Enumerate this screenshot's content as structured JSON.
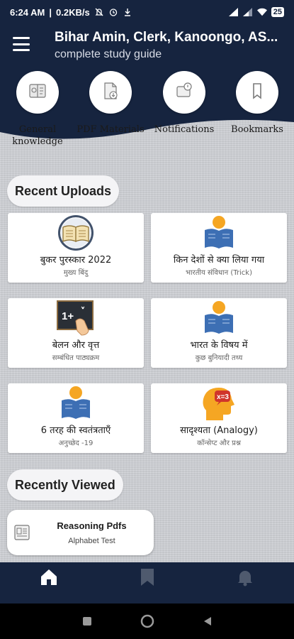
{
  "status_bar": {
    "time": "6:24 AM",
    "speed": "0.2KB/s",
    "battery": "25"
  },
  "header": {
    "title": "Bihar Amin, Clerk, Kanoongo, AS...",
    "subtitle": "complete study guide"
  },
  "quick_actions": [
    {
      "label": "General knowledge",
      "icon": "map-book-icon"
    },
    {
      "label": "PDF Materials",
      "icon": "pdf-download-icon"
    },
    {
      "label": "Notifications",
      "icon": "notification-bell-icon"
    },
    {
      "label": "Bookmarks",
      "icon": "bookmark-icon"
    }
  ],
  "recent_uploads": {
    "heading": "Recent Uploads",
    "items": [
      {
        "title": "बुकर पुरस्कार 2022",
        "subtitle": "मुख्य बिंदु",
        "icon": "open-book-icon"
      },
      {
        "title": "किन देशों से क्या लिया गया",
        "subtitle": "भारतीय संविधान (Trick)",
        "icon": "reader-icon"
      },
      {
        "title": "बेलन और वृत्त",
        "subtitle": "सम्बंधित पाठ्यक्रम",
        "icon": "blackboard-icon"
      },
      {
        "title": "भारत के विषय में",
        "subtitle": "कुछ बुनियादी तथ्य",
        "icon": "reader-icon"
      },
      {
        "title": "6 तरह की स्वतंत्रताएँ",
        "subtitle": "अनुच्छेद -19",
        "icon": "reader-icon"
      },
      {
        "title": "सादृश्यता (Analogy)",
        "subtitle": "कॉन्सेप्ट और प्रश्न",
        "icon": "head-math-icon"
      }
    ]
  },
  "recently_viewed": {
    "heading": "Recently Viewed",
    "items": [
      {
        "title": "Reasoning Pdfs",
        "subtitle": "Alphabet Test"
      }
    ]
  },
  "colors": {
    "primary": "#16243f",
    "accent_orange": "#f5a623",
    "accent_blue": "#3d6fb4"
  }
}
